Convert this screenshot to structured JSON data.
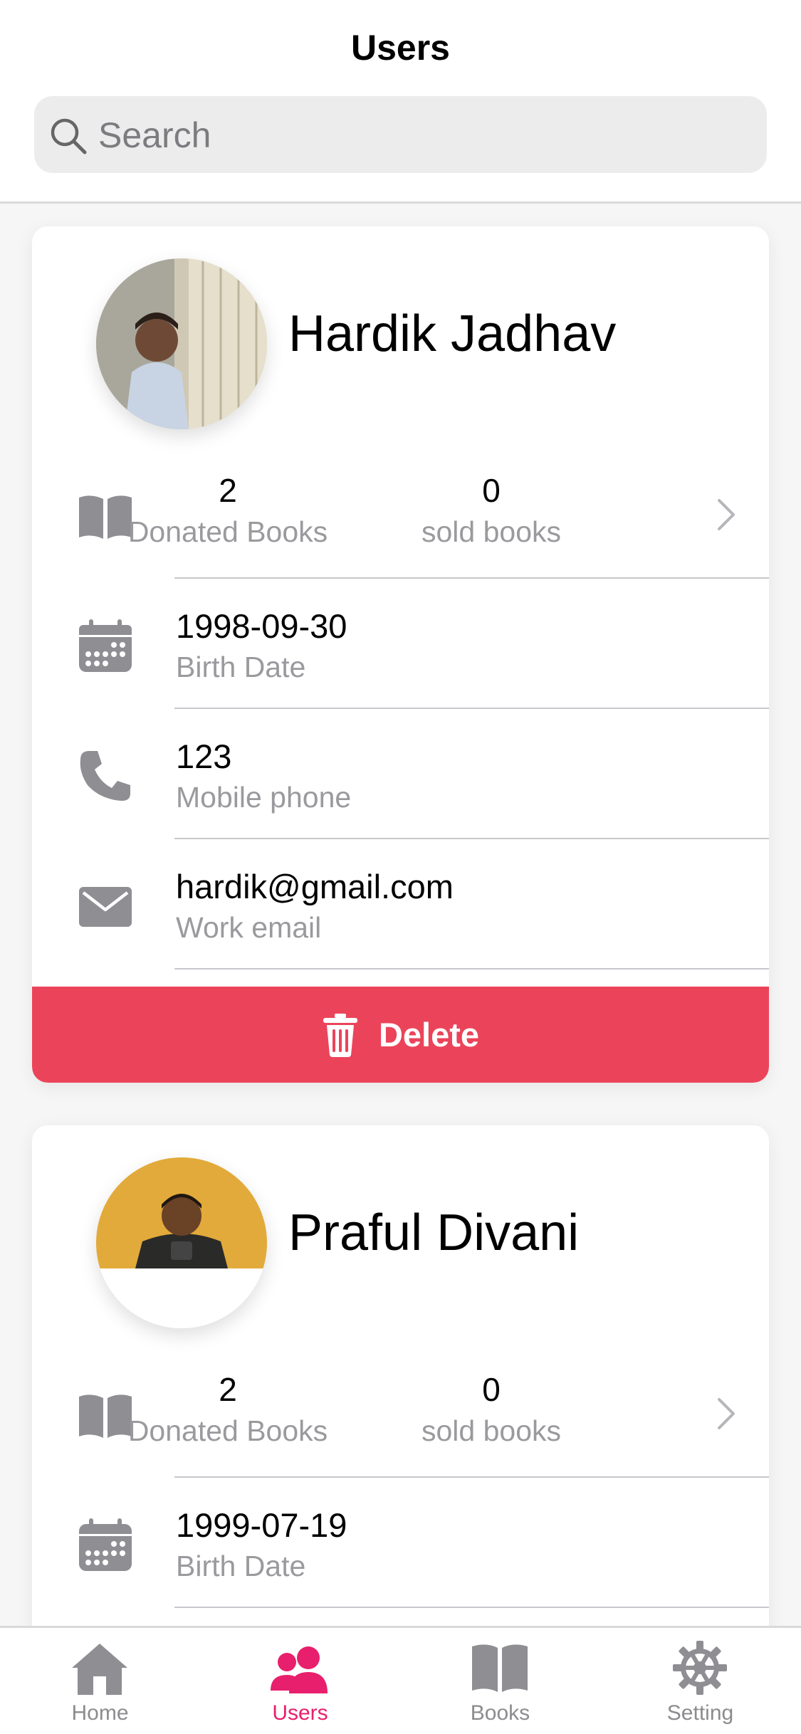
{
  "header": {
    "title": "Users"
  },
  "search": {
    "placeholder": "Search"
  },
  "users": [
    {
      "name": "Hardik Jadhav",
      "donated_books": "2",
      "donated_label": "Donated Books",
      "sold_books": "0",
      "sold_label": "sold books",
      "birth_date": "1998-09-30",
      "birth_label": "Birth Date",
      "phone": "123",
      "phone_label": "Mobile phone",
      "email": "hardik@gmail.com",
      "email_label": "Work email",
      "delete_label": "Delete"
    },
    {
      "name": "Praful Divani",
      "donated_books": "2",
      "donated_label": "Donated Books",
      "sold_books": "0",
      "sold_label": "sold books",
      "birth_date": "1999-07-19",
      "birth_label": "Birth Date"
    }
  ],
  "tabs": [
    {
      "label": "Home",
      "icon": "home-icon",
      "active": false
    },
    {
      "label": "Users",
      "icon": "users-icon",
      "active": true
    },
    {
      "label": "Books",
      "icon": "book-icon",
      "active": false
    },
    {
      "label": "Setting",
      "icon": "gear-icon",
      "active": false
    }
  ],
  "colors": {
    "accent": "#e81f6c",
    "delete": "#eb445a",
    "icon_gray": "#8e8e93",
    "label_gray": "#9a9a9e"
  }
}
